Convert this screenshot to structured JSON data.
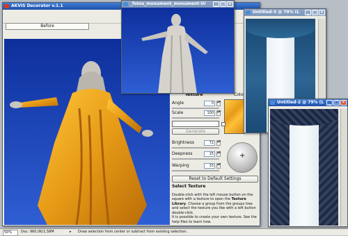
{
  "main": {
    "title": "AKVIS Decorator v.1.1",
    "before_tab": "Before"
  },
  "photo": {
    "title": "_fotos_monument_monument-Ui"
  },
  "untitled3": {
    "title": "Untitled-3 @ 79% (L"
  },
  "untitled2": {
    "title": "Untitled-2 @ 79% (L"
  },
  "panel": {
    "texture_label": "Texture",
    "color_label": "Color",
    "angle_label": "Angle",
    "angle_value": "0",
    "scale_label": "Scale",
    "scale_value": "100",
    "generate_label": "Generate",
    "brightness_label": "Brightness",
    "brightness_value": "72",
    "deepness_label": "Deepness",
    "deepness_value": "15",
    "warping_label": "Warping",
    "warping_value": "33",
    "reset_label": "Reset to Default Settings",
    "help_title": "Select Texture",
    "help_p1": "Double-click with the left mouse button on the square with a texture to open the ",
    "help_bold": "Texture Library",
    "help_p2": ". Choose a group from the groups tree and select the texture you like with a left button double-click.",
    "help_p3": "It is possible to create your own texture. See the help files to learn how."
  },
  "statusbar": {
    "zoom": "50%",
    "doc": "Doc: 960,0K/1,58M",
    "hint": "Draw selection from center or subtract from existing selection."
  },
  "colors": {
    "texture_swatch": "#f0a72a",
    "sky": "#1a43b8",
    "robe": "#e9a21c"
  }
}
